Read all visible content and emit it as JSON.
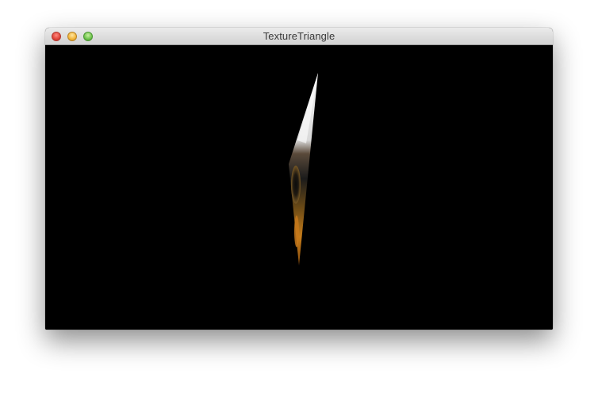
{
  "window": {
    "title": "TextureTriangle",
    "buttons": [
      "close",
      "minimize",
      "zoom"
    ]
  },
  "canvas": {
    "background": "#000000",
    "shape": "textured triangle"
  },
  "colors": {
    "close": "#e0443a",
    "minimize": "#f2b53a",
    "zoom": "#6cc24a"
  }
}
